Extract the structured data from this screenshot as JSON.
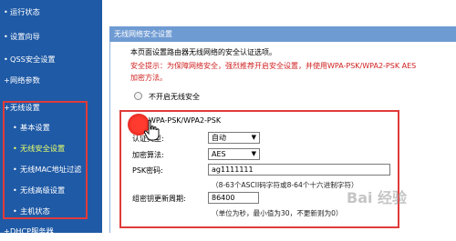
{
  "sidebar": {
    "items": [
      {
        "label": "运行状态"
      },
      {
        "label": "设置向导"
      },
      {
        "label": "QSS安全设置"
      },
      {
        "label": "网络参数"
      },
      {
        "label": "无线设置"
      },
      {
        "label": "基本设置"
      },
      {
        "label": "无线安全设置"
      },
      {
        "label": "无线MAC地址过滤"
      },
      {
        "label": "无线高级设置"
      },
      {
        "label": "主机状态"
      },
      {
        "label": "DHCP服务器"
      }
    ],
    "bullet": "•",
    "group_bullet": "+"
  },
  "main": {
    "header_title": "无线网络安全设置",
    "intro": "本页面设置路由器无线网络的安全认证选项。",
    "warning_line1": "安全提示：为保障网络安全，强烈推荐开启安全设置，并使用WPA-PSK/WPA2-PSK AES",
    "warning_line2": "加密方法。",
    "option_none": "不开启无线安全",
    "option_wpa": "WPA-PSK/WPA2-PSK",
    "auth_label": "认证类型:",
    "auth_value": "自动",
    "enc_label": "加密算法:",
    "enc_value": "AES",
    "psk_label": "PSK密码:",
    "psk_value": "ag1111111",
    "psk_hint": "（8-63个ASCII码字符或8-64个十六进制字符）",
    "renew_label": "组密钥更新周期:",
    "renew_value": "86400",
    "renew_hint": "（单位为秒，最小值为30，不更新则为0）"
  },
  "watermark": "Bai 经验",
  "colors": {
    "sidebar_bg": "#1f5aa6",
    "header_bg": "#6f9bd3",
    "highlight": "#e13a3a",
    "warning": "#d01f1f"
  }
}
